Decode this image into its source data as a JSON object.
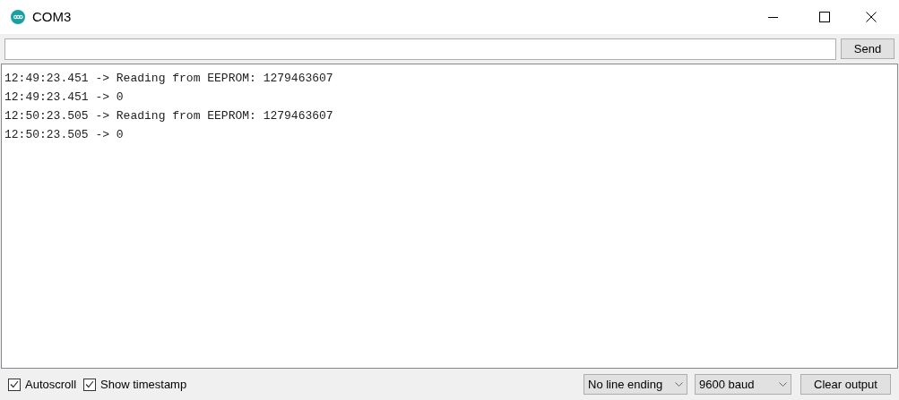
{
  "window": {
    "title": "COM3"
  },
  "send_button": "Send",
  "output_lines": [
    "12:49:23.451 -> Reading from EEPROM: 1279463607",
    "12:49:23.451 -> 0",
    "12:50:23.505 -> Reading from EEPROM: 1279463607",
    "12:50:23.505 -> 0"
  ],
  "options": [
    {
      "label": "Autoscroll",
      "checked": true
    },
    {
      "label": "Show timestamp",
      "checked": true
    }
  ],
  "line_ending": "No line ending",
  "baud": "9600 baud",
  "clear_button": "Clear output"
}
